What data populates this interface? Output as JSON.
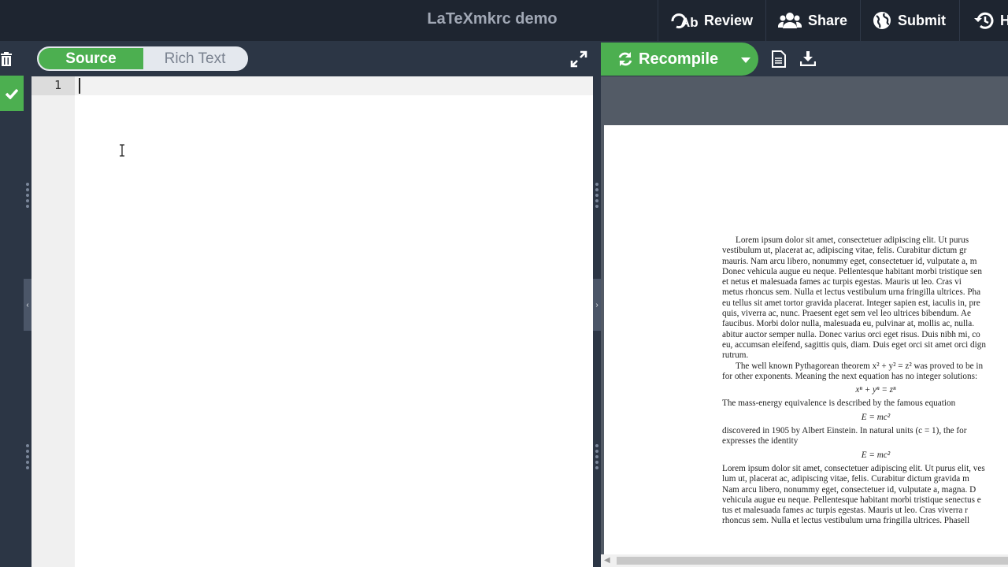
{
  "header": {
    "title": "LaTeXmkrc demo",
    "review_label": "Review",
    "share_label": "Share",
    "submit_label": "Submit",
    "history_label": "H"
  },
  "editor": {
    "mode_source": "Source",
    "mode_rich": "Rich Text",
    "active_mode": "Source",
    "line_numbers": [
      "1"
    ]
  },
  "pdf": {
    "recompile_label": "Recompile",
    "lines": [
      {
        "text": "Lorem ipsum dolor sit amet, consectetuer adipiscing elit.  Ut purus",
        "style": "ind"
      },
      {
        "text": "vestibulum ut, placerat ac, adipiscing vitae, felis.  Curabitur dictum gr",
        "style": ""
      },
      {
        "text": "mauris.  Nam arcu libero, nonummy eget, consectetuer id, vulputate a, m",
        "style": ""
      },
      {
        "text": "Donec vehicula augue eu neque.  Pellentesque habitant morbi tristique sen",
        "style": ""
      },
      {
        "text": "et netus et malesuada fames ac turpis egestas.  Mauris ut leo.  Cras vi",
        "style": ""
      },
      {
        "text": "metus rhoncus sem.  Nulla et lectus vestibulum urna fringilla ultrices.  Pha",
        "style": ""
      },
      {
        "text": "eu tellus sit amet tortor gravida placerat.  Integer sapien est, iaculis in, pre",
        "style": ""
      },
      {
        "text": "quis, viverra ac, nunc.  Praesent eget sem vel leo ultrices bibendum.  Ae",
        "style": ""
      },
      {
        "text": "faucibus.  Morbi dolor nulla, malesuada eu, pulvinar at, mollis ac, nulla.",
        "style": ""
      },
      {
        "text": "abitur auctor semper nulla.  Donec varius orci eget risus.  Duis nibh mi, co",
        "style": ""
      },
      {
        "text": "eu, accumsan eleifend, sagittis quis, diam.  Duis eget orci sit amet orci dign",
        "style": ""
      },
      {
        "text": "rutrum.",
        "style": ""
      },
      {
        "text": "The well known Pythagorean theorem x² + y² = z² was proved to be in",
        "style": "ind"
      },
      {
        "text": "for other exponents.  Meaning the next equation has no integer solutions:",
        "style": ""
      },
      {
        "text": "xⁿ + yⁿ = zⁿ",
        "style": "eq"
      },
      {
        "text": "The mass-energy equivalence is described by the famous equation",
        "style": ""
      },
      {
        "text": "E = mc²",
        "style": "eq"
      },
      {
        "text": "discovered in 1905 by Albert Einstein.  In natural units (c = 1), the for",
        "style": ""
      },
      {
        "text": "expresses the identity",
        "style": ""
      },
      {
        "text": "E = mc²",
        "style": "eq"
      },
      {
        "text": "Lorem ipsum dolor sit amet, consectetuer adipiscing elit. Ut purus elit, ves",
        "style": ""
      },
      {
        "text": "lum ut, placerat ac, adipiscing vitae, felis.  Curabitur dictum gravida m",
        "style": ""
      },
      {
        "text": "Nam arcu libero, nonummy eget, consectetuer id, vulputate a, magna.  D",
        "style": ""
      },
      {
        "text": "vehicula augue eu neque.  Pellentesque habitant morbi tristique senectus e",
        "style": ""
      },
      {
        "text": "tus et malesuada fames ac turpis egestas.  Mauris ut leo.  Cras viverra r",
        "style": ""
      },
      {
        "text": "rhoncus sem.  Nulla et lectus vestibulum urna fringilla ultrices.  Phasell",
        "style": ""
      }
    ]
  },
  "colors": {
    "accent": "#4caf50",
    "topbar": "#1e2530",
    "panel": "#2c3645"
  }
}
